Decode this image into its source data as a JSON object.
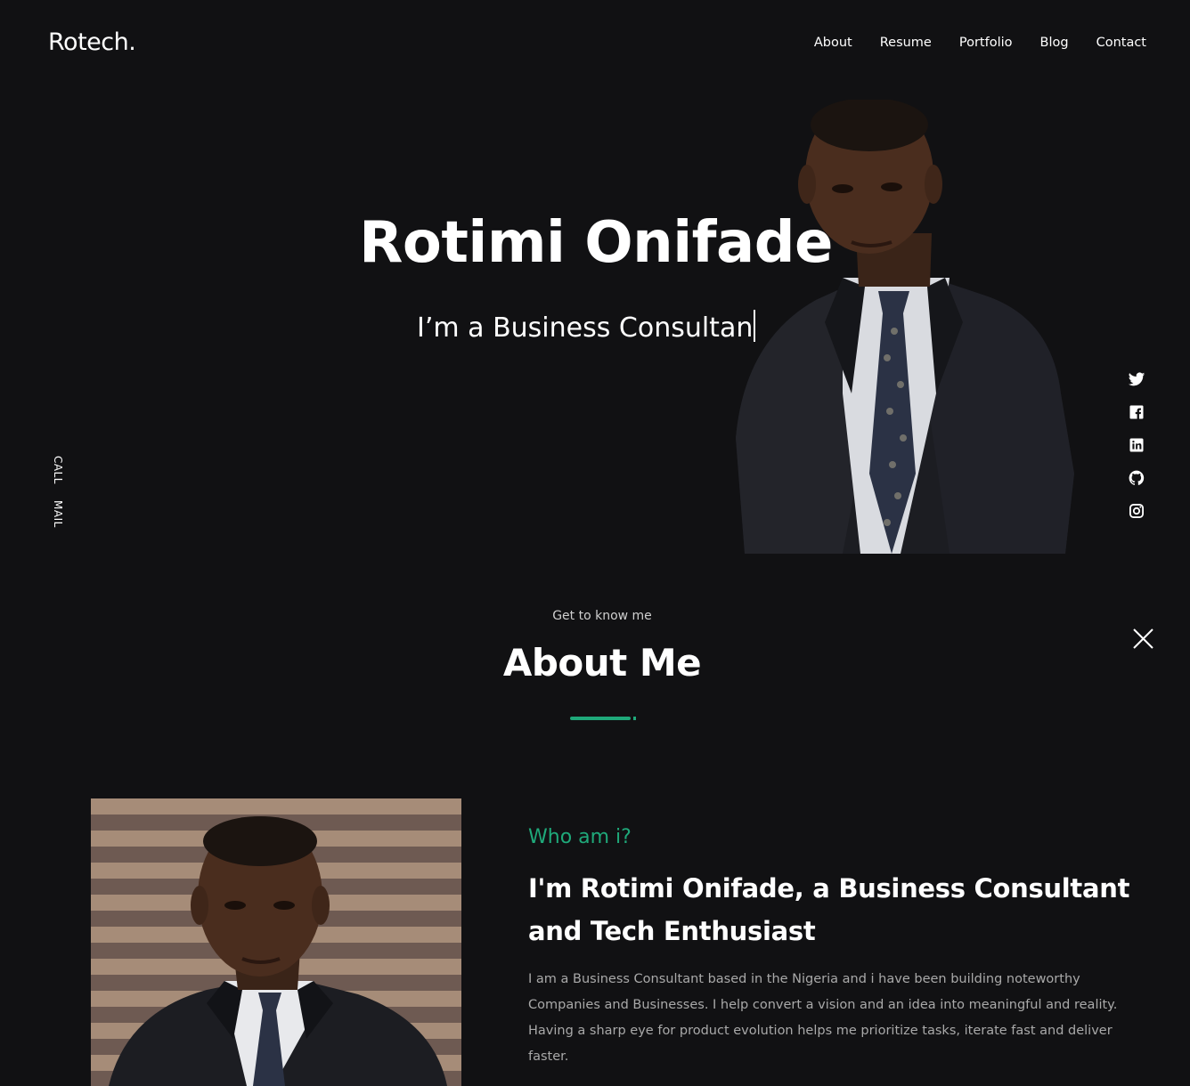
{
  "brand": {
    "logo": "Rotech."
  },
  "nav": {
    "items": [
      {
        "label": "About"
      },
      {
        "label": "Resume"
      },
      {
        "label": "Portfolio"
      },
      {
        "label": "Blog"
      },
      {
        "label": "Contact"
      }
    ]
  },
  "hero": {
    "name": "Rotimi Onifade",
    "typed_text": "I’m a Business Consultan",
    "photo_icon": "portrait-photo"
  },
  "side_links": {
    "call": "CALL",
    "mail": "MAIL"
  },
  "socials": [
    {
      "icon": "twitter-icon"
    },
    {
      "icon": "facebook-icon"
    },
    {
      "icon": "linkedin-icon"
    },
    {
      "icon": "github-icon"
    },
    {
      "icon": "instagram-icon"
    }
  ],
  "about": {
    "kicker": "Get to know me",
    "title": "About Me",
    "who": "Who am i?",
    "headline": "I'm Rotimi Onifade, a Business Consultant and Tech Enthusiast",
    "bio": "I am a Business Consultant based in the Nigeria and i have been building noteworthy Companies and Businesses. I help convert a vision and an idea into meaningful and reality. Having a sharp eye for product evolution helps me prioritize tasks, iterate fast and deliver faster."
  },
  "colors": {
    "background": "#111113",
    "accent": "#1fa97a",
    "text": "#ffffff",
    "muted": "#a9a9a9"
  }
}
